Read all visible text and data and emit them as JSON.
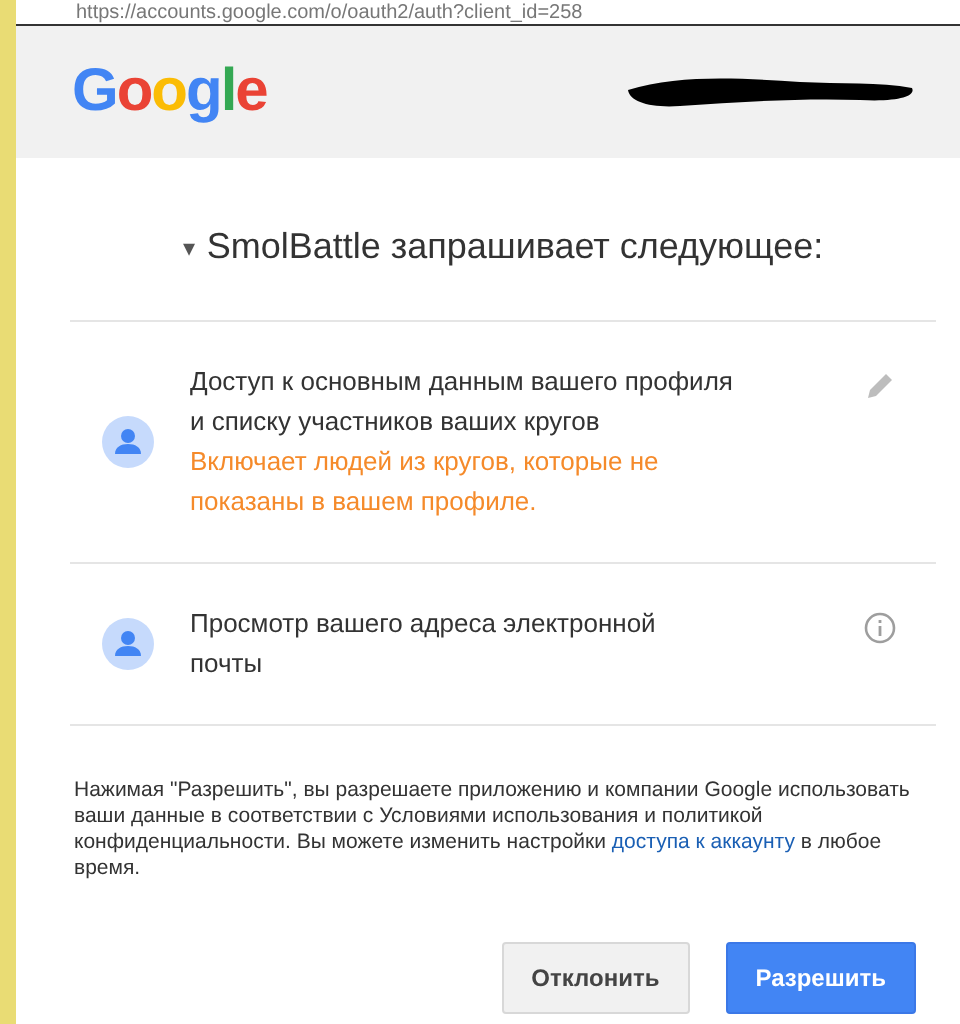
{
  "address_bar": {
    "url": "https://accounts.google.com/o/oauth2/auth?client_id=258"
  },
  "header": {
    "logo": "Google"
  },
  "title": {
    "caret": "▾",
    "text": "SmolBattle запрашивает следующее:"
  },
  "permissions": [
    {
      "text": "Доступ к основным данным вашего профиля и списку участников ваших кругов",
      "note": "Включает людей из кругов, которые не показаны в вашем профиле.",
      "kind": "edit"
    },
    {
      "text": "Просмотр вашего адреса электронной почты",
      "kind": "info"
    }
  ],
  "footer": {
    "text_before": "Нажимая \"Разрешить\", вы разрешаете приложению и компании Google использовать ваши данные в соответствии с Условиями использования и политикой конфиденциальности. Вы можете изменить настройки",
    "link": "доступа к аккаунту",
    "text_after": "в любое время."
  },
  "buttons": [
    {
      "label": "Отклонить",
      "kind": "secondary"
    },
    {
      "label": "Разрешить",
      "kind": "primary"
    }
  ]
}
